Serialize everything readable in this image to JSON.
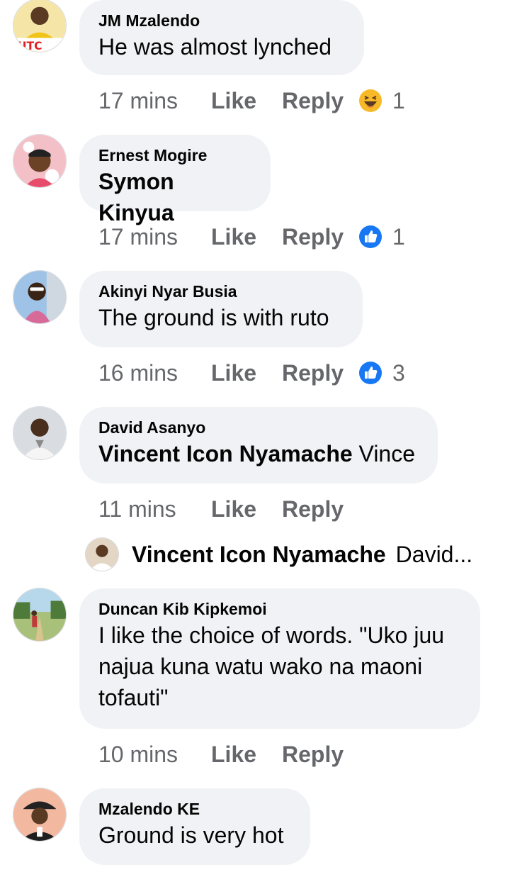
{
  "comments": [
    {
      "author": "JM Mzalendo",
      "text": "He was almost lynched",
      "time": "17 mins",
      "like_label": "Like",
      "reply_label": "Reply",
      "reaction": {
        "icon": "haha-emoji-icon",
        "count": "1"
      },
      "avatar_text": "UTC"
    },
    {
      "author": "Ernest Mogire",
      "mention": "Symon Kinyua",
      "time": "17 mins",
      "like_label": "Like",
      "reply_label": "Reply",
      "reaction": {
        "icon": "like-thumb-icon",
        "count": "1"
      }
    },
    {
      "author": "Akinyi Nyar Busia",
      "text": "The ground is with ruto",
      "time": "16 mins",
      "like_label": "Like",
      "reply_label": "Reply",
      "reaction": {
        "icon": "like-thumb-icon",
        "count": "3"
      }
    },
    {
      "author": "David Asanyo",
      "mention": "Vincent Icon Nyamache",
      "text": "Vince",
      "time": "11 mins",
      "like_label": "Like",
      "reply_label": "Reply",
      "reply_preview": {
        "author": "Vincent Icon Nyamache",
        "text": "David..."
      }
    },
    {
      "author": "Duncan Kib Kipkemoi",
      "text_lines": [
        "I like the choice of words. \"Uko juu",
        "najua kuna watu wako na maoni",
        "tofauti\""
      ],
      "time": "10 mins",
      "like_label": "Like",
      "reply_label": "Reply"
    },
    {
      "author": "Mzalendo KE",
      "text": "Ground is very hot"
    }
  ],
  "colors": {
    "bubble": "#f0f2f5",
    "meta_text": "#65676b",
    "like_blue": "#1877f2",
    "haha_yellow": "#f7b928"
  }
}
